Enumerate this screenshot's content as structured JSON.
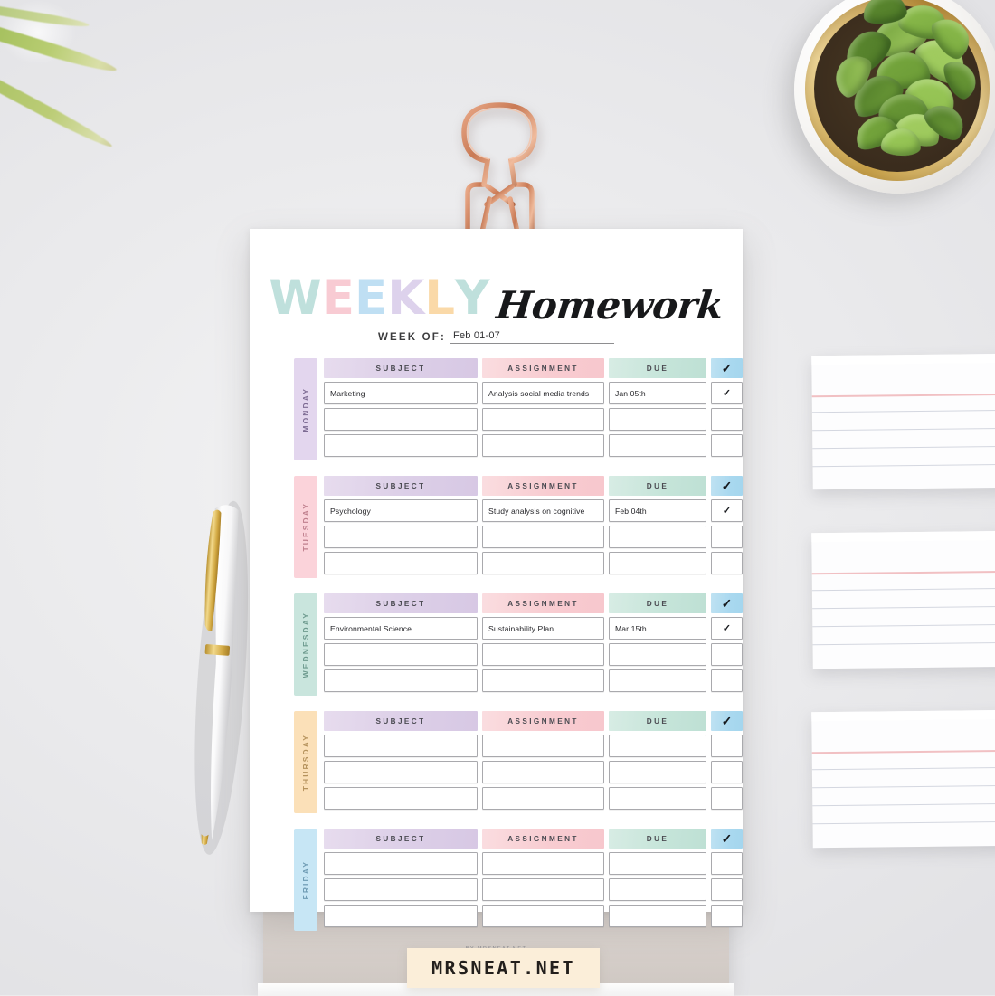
{
  "scene": {
    "desk_color": "#ebebed",
    "objects": {
      "plant": "succulent-in-white-gold-pot",
      "clip": "rose-gold-binder-clip",
      "pen": "white-gold-rollerball-pen",
      "cards": "lined-index-cards",
      "leaves": "green-leaf-stems"
    }
  },
  "planner": {
    "title_word": "WEEKLY",
    "title_letters": [
      {
        "ch": "W",
        "color": "#bfe0dc"
      },
      {
        "ch": "E",
        "color": "#f8cbd3"
      },
      {
        "ch": "E",
        "color": "#bfdff3"
      },
      {
        "ch": "K",
        "color": "#ddd2ec"
      },
      {
        "ch": "L",
        "color": "#fad9a8"
      },
      {
        "ch": "Y",
        "color": "#bfe0dc"
      }
    ],
    "script_title": "Homework",
    "week_of_label": "WEEK OF:",
    "week_of_value": "Feb 01-07",
    "columns": [
      "SUBJECT",
      "ASSIGNMENT",
      "DUE",
      "✓"
    ],
    "column_colors": {
      "subject": "#ddd0e8",
      "assignment": "#f8ccd1",
      "due": "#c5e4d9",
      "check": "#a9d8ef"
    },
    "check_mark": "✓",
    "days": [
      {
        "label": "MONDAY",
        "tab_color": "#e3d6ee",
        "tab_text_color": "#7d6b93",
        "rows": [
          {
            "subject": "Marketing",
            "assignment": "Analysis social media trends",
            "due": "Jan 05th",
            "done": "✓"
          },
          {
            "subject": "",
            "assignment": "",
            "due": "",
            "done": ""
          },
          {
            "subject": "",
            "assignment": "",
            "due": "",
            "done": ""
          }
        ]
      },
      {
        "label": "TUESDAY",
        "tab_color": "#fbd3da",
        "tab_text_color": "#bf7f8d",
        "rows": [
          {
            "subject": "Psychology",
            "assignment": "Study analysis on cognitive",
            "due": "Feb 04th",
            "done": "✓"
          },
          {
            "subject": "",
            "assignment": "",
            "due": "",
            "done": ""
          },
          {
            "subject": "",
            "assignment": "",
            "due": "",
            "done": ""
          }
        ]
      },
      {
        "label": "WEDNESDAY",
        "tab_color": "#c9e5dd",
        "tab_text_color": "#6d9a8e",
        "rows": [
          {
            "subject": "Environmental Science",
            "assignment": "Sustainability Plan",
            "due": "Mar 15th",
            "done": "✓"
          },
          {
            "subject": "",
            "assignment": "",
            "due": "",
            "done": ""
          },
          {
            "subject": "",
            "assignment": "",
            "due": "",
            "done": ""
          }
        ]
      },
      {
        "label": "THURSDAY",
        "tab_color": "#fbe0b8",
        "tab_text_color": "#b5925c",
        "rows": [
          {
            "subject": "",
            "assignment": "",
            "due": "",
            "done": ""
          },
          {
            "subject": "",
            "assignment": "",
            "due": "",
            "done": ""
          },
          {
            "subject": "",
            "assignment": "",
            "due": "",
            "done": ""
          }
        ]
      },
      {
        "label": "FRIDAY",
        "tab_color": "#c7e6f5",
        "tab_text_color": "#6d9ab3",
        "rows": [
          {
            "subject": "",
            "assignment": "",
            "due": "",
            "done": ""
          },
          {
            "subject": "",
            "assignment": "",
            "due": "",
            "done": ""
          },
          {
            "subject": "",
            "assignment": "",
            "due": "",
            "done": ""
          }
        ]
      }
    ],
    "byline": "BY MRSNEAT.NET"
  },
  "banner": {
    "text": "MRSNEAT.NET",
    "background": "#fbeed9",
    "text_color": "#231f1c"
  }
}
